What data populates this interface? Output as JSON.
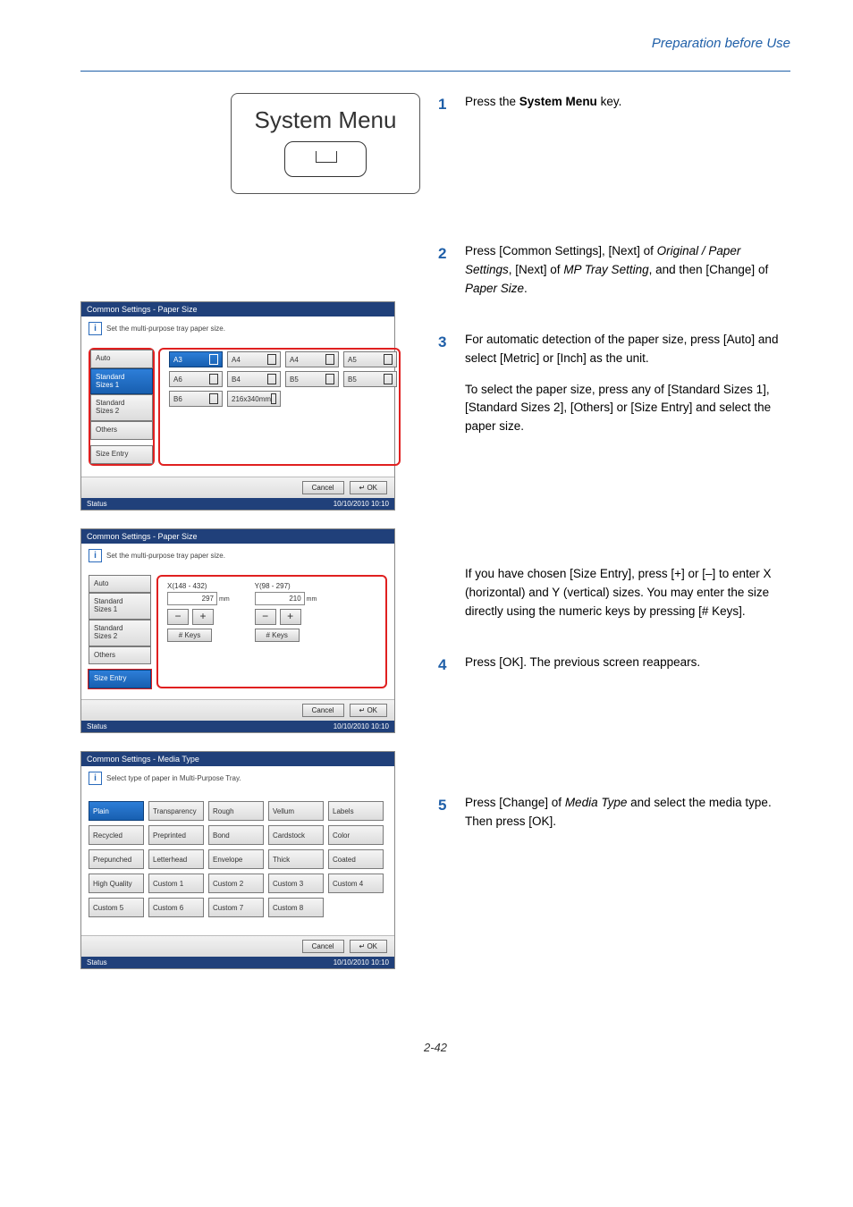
{
  "header": {
    "section_title": "Preparation before Use"
  },
  "sysmenu": {
    "label": "System Menu"
  },
  "steps": {
    "s1": {
      "num": "1",
      "text_a": "Press the ",
      "bold": "System Menu",
      "text_b": " key."
    },
    "s2": {
      "num": "2",
      "text": "Press [Common Settings], [Next] of ",
      "i1": "Original / Paper Settings",
      "t2": ", [Next] of ",
      "i2": "MP Tray Setting",
      "t3": ", and then [Change] of ",
      "i3": "Paper Size",
      "t4": "."
    },
    "s3": {
      "num": "3",
      "p1": "For automatic detection of the paper size, press [Auto] and select [Metric] or [Inch] as the unit.",
      "p2": "To select the paper size, press any of [Standard Sizes 1], [Standard Sizes 2], [Others] or [Size Entry] and select the paper size.",
      "p3": "If you have chosen [Size Entry], press [+] or [–] to enter X (horizontal) and Y (vertical) sizes. You may enter the size directly using the numeric keys by pressing [# Keys]."
    },
    "s4": {
      "num": "4",
      "text": "Press [OK]. The previous screen reappears."
    },
    "s5": {
      "num": "5",
      "text_a": "Press [Change] of ",
      "i1": "Media Type",
      "text_b": " and select the media type. Then press [OK]."
    }
  },
  "panel_common": {
    "status_label": "Status",
    "timestamp": "10/10/2010   10:10",
    "cancel": "Cancel",
    "ok": "OK"
  },
  "panel1": {
    "title": "Common Settings - Paper Size",
    "msg": "Set the multi-purpose tray paper size.",
    "tabs": [
      "Auto",
      "Standard\nSizes 1",
      "Standard\nSizes 2",
      "Others",
      "Size Entry"
    ],
    "sizes_row1": [
      "A3",
      "A4",
      "A4",
      "A5"
    ],
    "sizes_row2": [
      "A6",
      "B4",
      "B5",
      "B5"
    ],
    "sizes_row3": [
      "B6",
      "216x340mm"
    ]
  },
  "panel2": {
    "title": "Common Settings - Paper Size",
    "msg": "Set the multi-purpose tray paper size.",
    "tabs": [
      "Auto",
      "Standard\nSizes 1",
      "Standard\nSizes 2",
      "Others",
      "Size Entry"
    ],
    "x_label": "X(148 - 432)",
    "y_label": "Y(98 - 297)",
    "x_value": "297",
    "y_value": "210",
    "mm": "mm",
    "hashkeys": "# Keys"
  },
  "panel3": {
    "title": "Common Settings - Media Type",
    "msg": "Select type of paper in Multi-Purpose Tray.",
    "grid": [
      [
        "Plain",
        "Transparency",
        "Rough",
        "Vellum",
        "Labels"
      ],
      [
        "Recycled",
        "Preprinted",
        "Bond",
        "Cardstock",
        "Color"
      ],
      [
        "Prepunched",
        "Letterhead",
        "Envelope",
        "Thick",
        "Coated"
      ],
      [
        "High Quality",
        "Custom 1",
        "Custom 2",
        "Custom 3",
        "Custom 4"
      ],
      [
        "Custom 5",
        "Custom 6",
        "Custom 7",
        "Custom 8"
      ]
    ]
  },
  "footer": {
    "page": "2-42"
  }
}
